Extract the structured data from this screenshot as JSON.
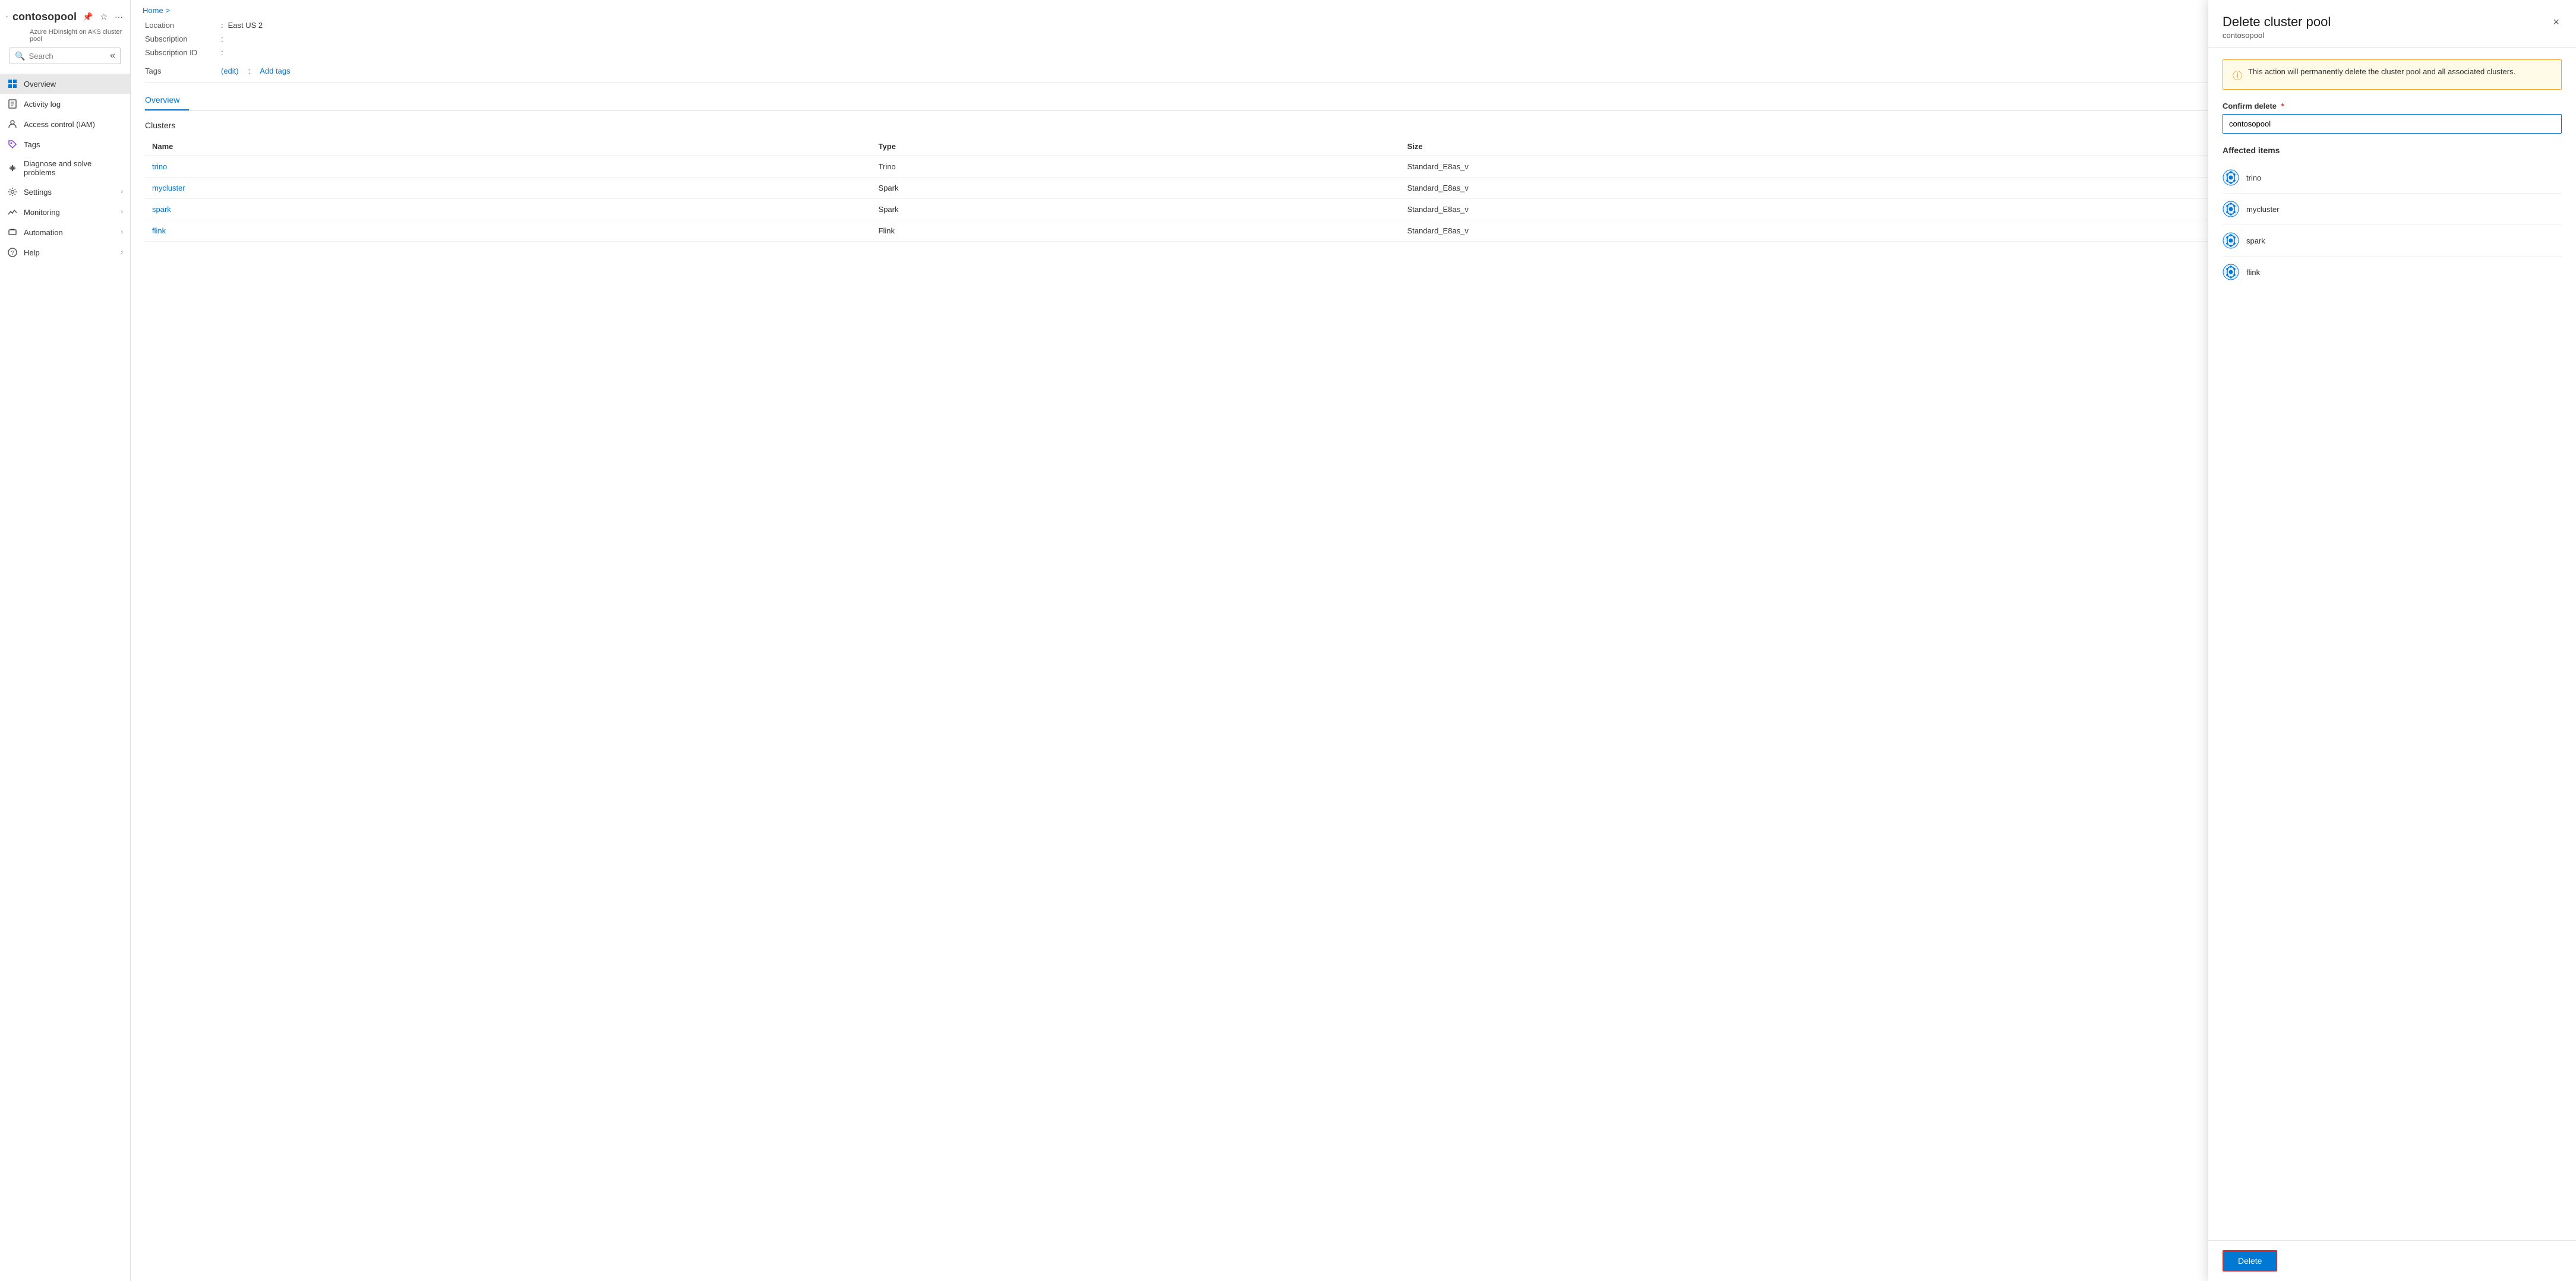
{
  "breadcrumb": {
    "home": "Home",
    "separator": ">"
  },
  "sidebar": {
    "resource_name": "contosopool",
    "resource_subtitle": "Azure HDInsight on AKS cluster pool",
    "pin_icon": "📌",
    "star_icon": "☆",
    "more_icon": "...",
    "search_placeholder": "Search",
    "collapse_label": "«",
    "nav_items": [
      {
        "id": "overview",
        "label": "Overview",
        "icon": "grid",
        "active": true,
        "expandable": false
      },
      {
        "id": "activity-log",
        "label": "Activity log",
        "icon": "doc",
        "active": false,
        "expandable": false
      },
      {
        "id": "access-control",
        "label": "Access control (IAM)",
        "icon": "person",
        "active": false,
        "expandable": false
      },
      {
        "id": "tags",
        "label": "Tags",
        "icon": "tag",
        "active": false,
        "expandable": false
      },
      {
        "id": "diagnose",
        "label": "Diagnose and solve problems",
        "icon": "wrench",
        "active": false,
        "expandable": false
      },
      {
        "id": "settings",
        "label": "Settings",
        "icon": "gear",
        "active": false,
        "expandable": true
      },
      {
        "id": "monitoring",
        "label": "Monitoring",
        "icon": "chart",
        "active": false,
        "expandable": true
      },
      {
        "id": "automation",
        "label": "Automation",
        "icon": "auto",
        "active": false,
        "expandable": true
      },
      {
        "id": "help",
        "label": "Help",
        "icon": "help",
        "active": false,
        "expandable": true
      }
    ]
  },
  "main": {
    "details": [
      {
        "label": "Location",
        "separator": ":",
        "value": "East US 2"
      },
      {
        "label": "Subscription",
        "separator": ":",
        "value": ""
      },
      {
        "label": "Subscription ID",
        "separator": ":",
        "value": ""
      }
    ],
    "tags_label": "Tags",
    "tags_edit": "(edit)",
    "tags_separator": ":",
    "tags_add": "Add tags",
    "tab_active": "Overview",
    "section_title": "Clusters",
    "table_headers": [
      "Name",
      "Type",
      "Size"
    ],
    "clusters": [
      {
        "name": "trino",
        "type": "Trino",
        "size": "Standard_E8as_v"
      },
      {
        "name": "mycluster",
        "type": "Spark",
        "size": "Standard_E8as_v"
      },
      {
        "name": "spark",
        "type": "Spark",
        "size": "Standard_E8as_v"
      },
      {
        "name": "flink",
        "type": "Flink",
        "size": "Standard_E8as_v"
      }
    ]
  },
  "delete_panel": {
    "title": "Delete cluster pool",
    "subtitle": "contosopool",
    "close_label": "×",
    "warning_text": "This action will permanently delete the cluster pool and all associated clusters.",
    "confirm_label": "Confirm delete",
    "required_marker": "*",
    "confirm_value": "contosopool",
    "affected_title": "Affected items",
    "affected_items": [
      {
        "name": "trino"
      },
      {
        "name": "mycluster"
      },
      {
        "name": "spark"
      },
      {
        "name": "flink"
      }
    ],
    "delete_button_label": "Delete"
  },
  "colors": {
    "accent": "#0078d4",
    "danger": "#d92c2c",
    "warning_bg": "#fffbe6",
    "warning_border": "#f5a623"
  }
}
